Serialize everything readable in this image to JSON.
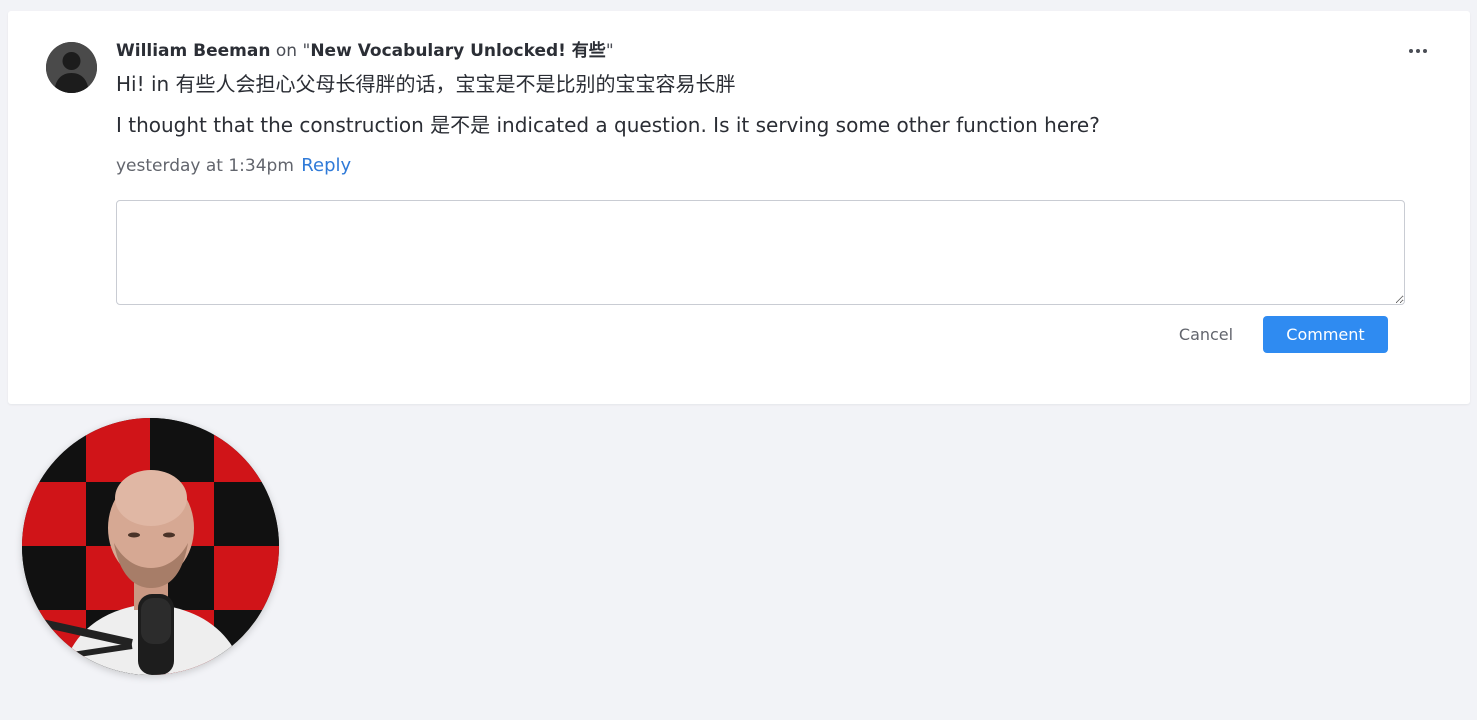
{
  "comment": {
    "author": "William Beeman",
    "on_word": "on",
    "topic_title": "New Vocabulary Unlocked! 有些",
    "line1": "Hi! in 有些人会担心父母长得胖的话，宝宝是不是比别的宝宝容易长胖",
    "line2": "I thought that the construction 是不是 indicated a question. Is it serving some other function here?",
    "timestamp": "yesterday at 1:34pm",
    "reply_label": "Reply"
  },
  "reply_form": {
    "value": "",
    "cancel_label": "Cancel",
    "submit_label": "Comment"
  },
  "icons": {
    "avatar": "user-silhouette-icon",
    "more": "more-horizontal-icon"
  },
  "colors": {
    "background": "#f2f3f7",
    "card": "#ffffff",
    "accent": "#2f8bf1",
    "link": "#2f7ad8",
    "text": "#2b2e35",
    "muted": "#62656d"
  }
}
